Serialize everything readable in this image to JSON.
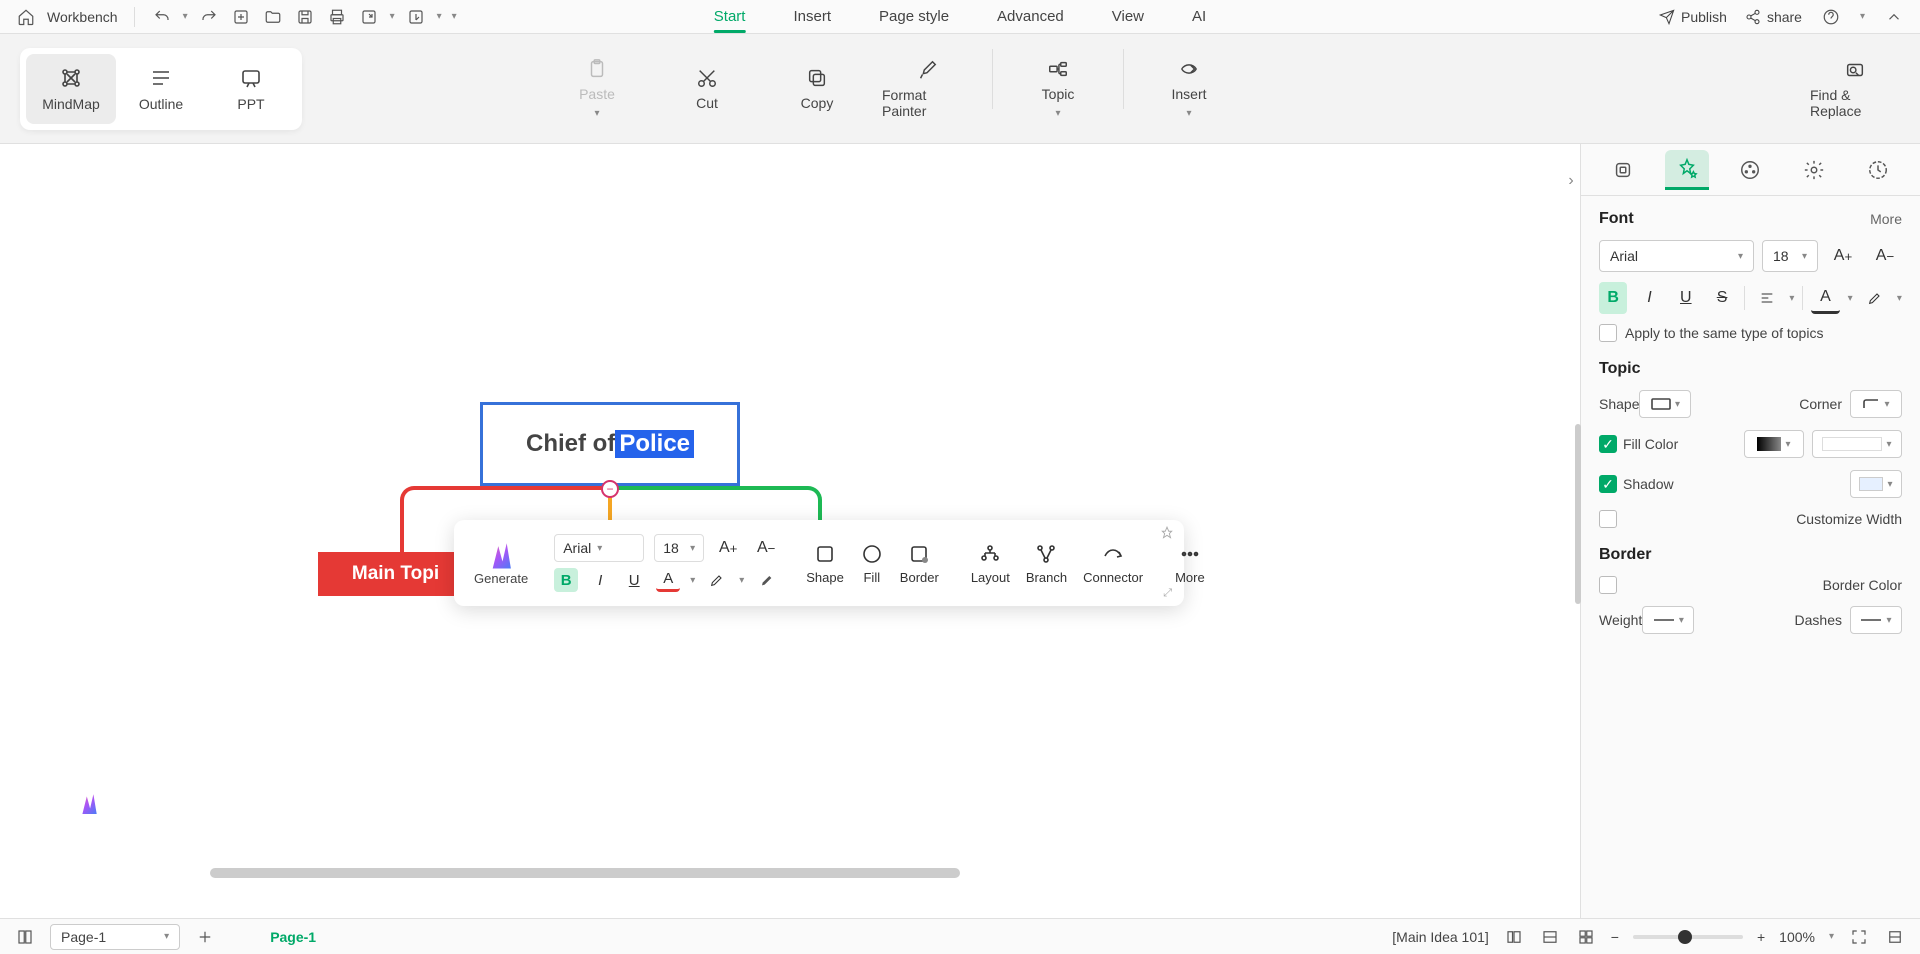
{
  "topbar": {
    "workbench": "Workbench",
    "tabs": [
      "Start",
      "Insert",
      "Page style",
      "Advanced",
      "View",
      "AI"
    ],
    "active_tab": 0,
    "publish": "Publish",
    "share": "share"
  },
  "ribbon": {
    "views": {
      "mindmap": "MindMap",
      "outline": "Outline",
      "ppt": "PPT"
    },
    "paste": "Paste",
    "cut": "Cut",
    "copy": "Copy",
    "format_painter": "Format Painter",
    "topic": "Topic",
    "insert": "Insert",
    "find_replace": "Find & Replace"
  },
  "canvas": {
    "central_prefix": "Chief of ",
    "central_selected": "Police",
    "main_topic": "Main Topi"
  },
  "float": {
    "generate": "Generate",
    "font": "Arial",
    "size": "18",
    "shape": "Shape",
    "fill": "Fill",
    "border": "Border",
    "layout": "Layout",
    "branch": "Branch",
    "connector": "Connector",
    "more": "More"
  },
  "panel": {
    "font_header": "Font",
    "more": "More",
    "font_name": "Arial",
    "font_size": "18",
    "apply_same": "Apply to the same type of topics",
    "topic_header": "Topic",
    "shape": "Shape",
    "corner": "Corner",
    "fill_color": "Fill Color",
    "shadow": "Shadow",
    "customize_width": "Customize Width",
    "border_header": "Border",
    "border_color": "Border Color",
    "weight": "Weight",
    "dashes": "Dashes"
  },
  "bottom": {
    "page_dropdown": "Page-1",
    "page_tab": "Page-1",
    "status": "[Main Idea 101]",
    "zoom": "100%"
  }
}
